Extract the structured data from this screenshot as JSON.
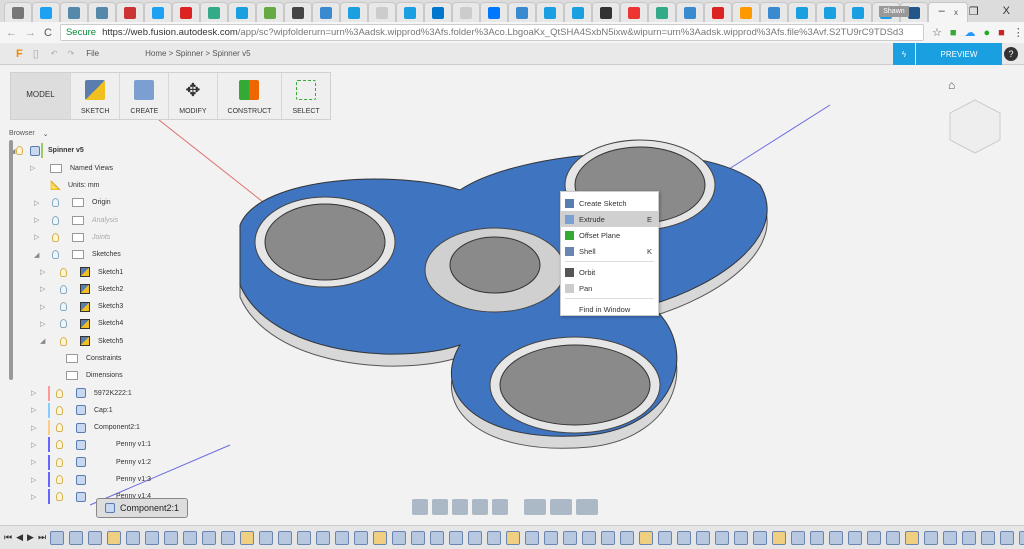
{
  "browser_tabs": {
    "count": 35,
    "active_close": "x"
  },
  "window": {
    "user": "Shawn",
    "minimize": "–",
    "maximize": "❐",
    "close": "X"
  },
  "address": {
    "secure_label": "Secure",
    "url_host": "https://web.fusion.autodesk.com",
    "url_path": "/app/sc?wipfolderurn=urn%3Aadsk.wipprod%3Afs.folder%3Aco.LbgoaKx_QtSHA4SxbN5ixw&wipurn=urn%3Aadsk.wipprod%3Afs.file%3Avf.S2TU9rC9TDSd3"
  },
  "app": {
    "file_label": "File",
    "breadcrumb": [
      "Home",
      "Spinner",
      "Spinner v5"
    ],
    "preview_label": "PREVIEW",
    "help": "?"
  },
  "toolbar": {
    "mode": "MODEL",
    "groups": [
      "SKETCH",
      "CREATE",
      "MODIFY",
      "CONSTRUCT",
      "SELECT"
    ]
  },
  "browser": {
    "title": "Browser",
    "items": [
      {
        "label": "Spinner v5",
        "level": 0
      },
      {
        "label": "Named Views",
        "level": 1
      },
      {
        "label": "Units: mm",
        "level": 1
      },
      {
        "label": "Origin",
        "level": 1
      },
      {
        "label": "Analysis",
        "level": 1
      },
      {
        "label": "Joints",
        "level": 1
      },
      {
        "label": "Sketches",
        "level": 1
      },
      {
        "label": "Sketch1",
        "level": 2
      },
      {
        "label": "Sketch2",
        "level": 2
      },
      {
        "label": "Sketch3",
        "level": 2
      },
      {
        "label": "Sketch4",
        "level": 2
      },
      {
        "label": "Sketch5",
        "level": 2
      },
      {
        "label": "Constraints",
        "level": 3
      },
      {
        "label": "Dimensions",
        "level": 3
      },
      {
        "label": "5972K222:1",
        "level": 1
      },
      {
        "label": "Cap:1",
        "level": 1
      },
      {
        "label": "Component2:1",
        "level": 1
      },
      {
        "label": "Penny v1:1",
        "level": 2
      },
      {
        "label": "Penny v1:2",
        "level": 2
      },
      {
        "label": "Penny v1:3",
        "level": 2
      },
      {
        "label": "Penny v1:4",
        "level": 2
      }
    ]
  },
  "context_menu": {
    "items": [
      {
        "label": "Create Sketch",
        "shortcut": ""
      },
      {
        "label": "Extrude",
        "shortcut": "E"
      },
      {
        "label": "Offset Plane",
        "shortcut": ""
      },
      {
        "label": "Shell",
        "shortcut": "K"
      },
      {
        "label": "Orbit",
        "shortcut": ""
      },
      {
        "label": "Pan",
        "shortcut": ""
      },
      {
        "label": "Find in Window",
        "shortcut": ""
      }
    ]
  },
  "tooltip": {
    "label": "Component2:1"
  },
  "colors": {
    "accent": "#1a9fe0",
    "body": "#3f74c0",
    "cap": "#8a8a8a"
  }
}
